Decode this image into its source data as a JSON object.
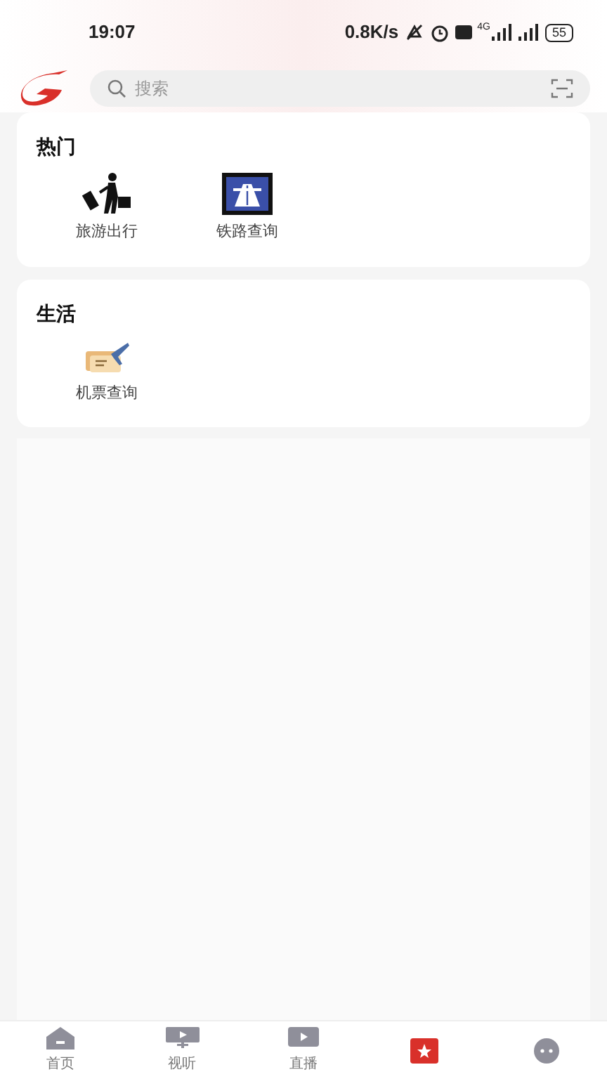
{
  "status_bar": {
    "time": "19:07",
    "speed": "0.8K/s",
    "network": "4G",
    "battery": "55"
  },
  "search": {
    "placeholder": "搜索"
  },
  "sections": [
    {
      "title": "热门",
      "items": [
        {
          "label": "旅游出行"
        },
        {
          "label": "铁路查询"
        }
      ]
    },
    {
      "title": "生活",
      "items": [
        {
          "label": "机票查询"
        }
      ]
    }
  ],
  "tab_bar": [
    {
      "label": "首页",
      "selected": false
    },
    {
      "label": "视听",
      "selected": false
    },
    {
      "label": "直播",
      "selected": false
    },
    {
      "selected": true
    },
    {
      "selected": false
    }
  ]
}
